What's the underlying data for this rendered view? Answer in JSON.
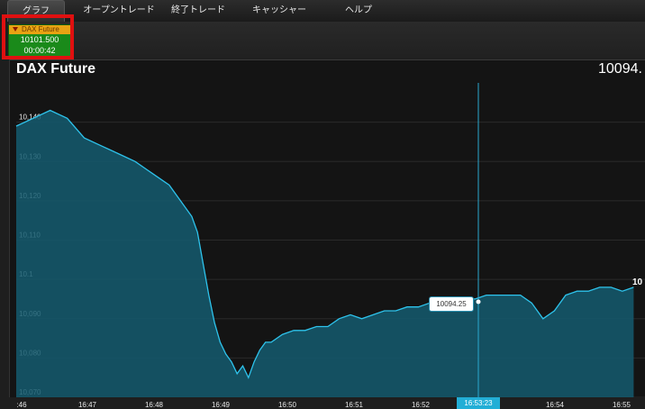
{
  "menu": {
    "tabs": [
      {
        "label": "グラフ"
      },
      {
        "label": "オープントレード"
      },
      {
        "label": "終了トレード"
      },
      {
        "label": "キャッシャー"
      },
      {
        "label": "ヘルプ"
      }
    ]
  },
  "instrument": {
    "name": "DAX Future",
    "price": "10101.500",
    "timer": "00:00:42"
  },
  "chart": {
    "title": "DAX Future",
    "current_value": "10094.",
    "tooltip_value": "10094.25",
    "right_label": "10",
    "crosshair_time": "16:53:23"
  },
  "chart_data": {
    "type": "area",
    "title": "DAX Future",
    "ylim": [
      10070,
      10150
    ],
    "y_ticks": [
      "10,140",
      "10,130",
      "10,120",
      "10,110",
      "10.1",
      "10,090",
      "10,080",
      "10,070"
    ],
    "x_ticks": [
      ":46",
      "16:47",
      "16:48",
      "16:49",
      "16:50",
      "16:51",
      "16:52",
      "16:53:23",
      "16:54",
      "16:55"
    ],
    "series": [
      {
        "x": [
          "16:46:15",
          "16:46:30",
          "16:46:45",
          "16:47:00",
          "16:47:15",
          "16:47:30",
          "16:47:45",
          "16:48:00",
          "16:48:10",
          "16:48:20",
          "16:48:30",
          "16:48:40",
          "16:48:50",
          "16:48:55",
          "16:49:00",
          "16:49:05",
          "16:49:10",
          "16:49:15",
          "16:49:20",
          "16:49:25",
          "16:49:30",
          "16:49:35",
          "16:49:40",
          "16:49:45",
          "16:49:50",
          "16:49:55",
          "16:50:00",
          "16:50:10",
          "16:50:20",
          "16:50:30",
          "16:50:40",
          "16:50:50",
          "16:51:00",
          "16:51:10",
          "16:51:20",
          "16:51:30",
          "16:51:40",
          "16:51:50",
          "16:52:00",
          "16:52:10",
          "16:52:20",
          "16:52:30",
          "16:52:40",
          "16:52:50",
          "16:53:00",
          "16:53:10",
          "16:53:20",
          "16:53:30",
          "16:53:40",
          "16:53:50",
          "16:54:00",
          "16:54:10",
          "16:54:20",
          "16:54:30",
          "16:54:40",
          "16:54:50",
          "16:55:00",
          "16:55:10",
          "16:55:20"
        ],
        "y": [
          10139,
          10141,
          10143,
          10141,
          10136,
          10134,
          10132,
          10130,
          10128,
          10126,
          10124,
          10120,
          10116,
          10112,
          10104,
          10096,
          10089,
          10084,
          10081,
          10079,
          10076,
          10078,
          10075,
          10079,
          10082,
          10084,
          10084,
          10086,
          10087,
          10087,
          10088,
          10088,
          10090,
          10091,
          10090,
          10091,
          10092,
          10092,
          10093,
          10093,
          10094,
          10092,
          10094,
          10095,
          10095,
          10096,
          10096,
          10096,
          10096,
          10094,
          10090,
          10092,
          10096,
          10097,
          10097,
          10098,
          10098,
          10097,
          10098
        ]
      }
    ]
  },
  "colors": {
    "line": "#2ec3ec",
    "fill": "#145a6e",
    "instrument_bg": "#1a8a1a",
    "instrument_header": "#e8a313",
    "highlight": "#e01010",
    "crosshair_badge": "#22aed6"
  }
}
